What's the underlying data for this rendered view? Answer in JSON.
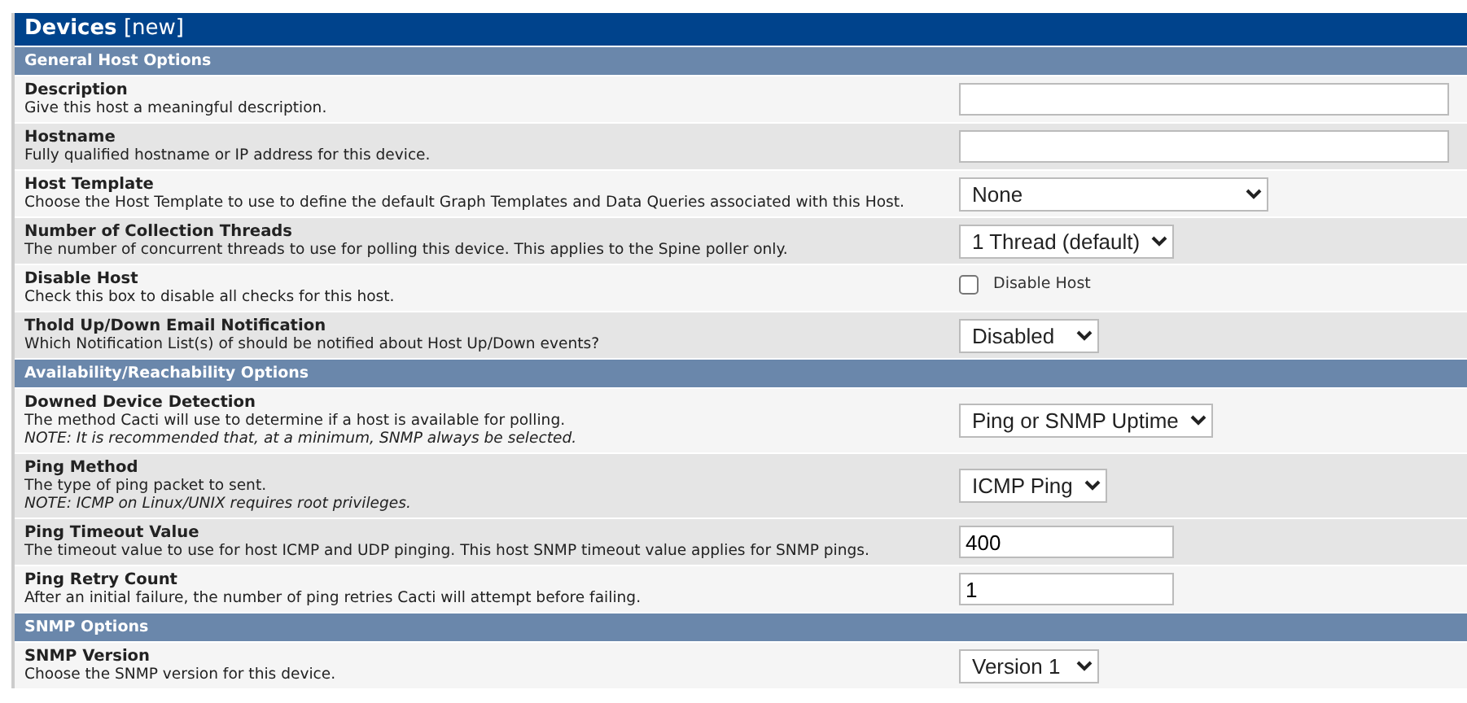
{
  "header": {
    "title": "**Devices** [new]"
  },
  "sections": [
    {
      "title": "General Host Options",
      "rows": [
        {
          "label": "Description",
          "description": [
            "Give this host a meaningful description."
          ],
          "shaded": false,
          "control": {
            "kind": "text"
          }
        },
        {
          "label": "Hostname",
          "description": [
            "Fully qualified hostname or IP address for this device."
          ],
          "shaded": true,
          "control": {
            "kind": "text"
          }
        },
        {
          "label": "Host Template",
          "description": [
            "Choose the Host Template to use to define the default Graph Templates and Data Queries associated with this Host."
          ],
          "shaded": false,
          "control": {
            "kind": "select",
            "value": "None"
          }
        },
        {
          "label": "Number of Collection Threads",
          "description": [
            "The number of concurrent threads to use for polling this device. This applies to the Spine poller only."
          ],
          "shaded": true,
          "control": {
            "kind": "select",
            "value": "1 Thread (default)"
          }
        },
        {
          "label": "Disable Host",
          "description": [
            "Check this box to disable all checks for this host."
          ],
          "shaded": false,
          "control": {
            "kind": "checkbox",
            "label": "Disable Host",
            "checked": false
          }
        },
        {
          "label": "Thold Up/Down Email Notification",
          "description": [
            "Which Notification List(s) of should be notified about Host Up/Down events?"
          ],
          "shaded": true,
          "control": {
            "kind": "select",
            "value": "Disabled"
          }
        }
      ]
    },
    {
      "title": "Availability/Reachability Options",
      "rows": [
        {
          "label": "Downed Device Detection",
          "description": [
            "The method Cacti will use to determine if a host is available for polling."
          ],
          "note": "NOTE: It is recommended that, at a minimum, SNMP always be selected.",
          "shaded": false,
          "control": {
            "kind": "select",
            "value": "Ping or SNMP Uptime"
          }
        },
        {
          "label": "Ping Method",
          "description": [
            "The type of ping packet to sent."
          ],
          "note": "NOTE: ICMP on Linux/UNIX requires root privileges.",
          "shaded": true,
          "control": {
            "kind": "select",
            "value": "ICMP Ping"
          }
        },
        {
          "label": "Ping Timeout Value",
          "description": [
            "The timeout value to use for host ICMP and UDP pinging. This host SNMP timeout value applies for SNMP pings."
          ],
          "shaded": true,
          "control": {
            "kind": "number",
            "value": "400"
          }
        },
        {
          "label": "Ping Retry Count",
          "description": [
            "After an initial failure, the number of ping retries Cacti will attempt before failing."
          ],
          "shaded": false,
          "control": {
            "kind": "number",
            "value": "1"
          }
        }
      ]
    },
    {
      "title": "SNMP Options",
      "rows": [
        {
          "label": "SNMP Version",
          "description": [
            "Choose the SNMP version for this device."
          ],
          "shaded": false,
          "control": {
            "kind": "select",
            "value": "Version 1"
          }
        }
      ]
    }
  ]
}
